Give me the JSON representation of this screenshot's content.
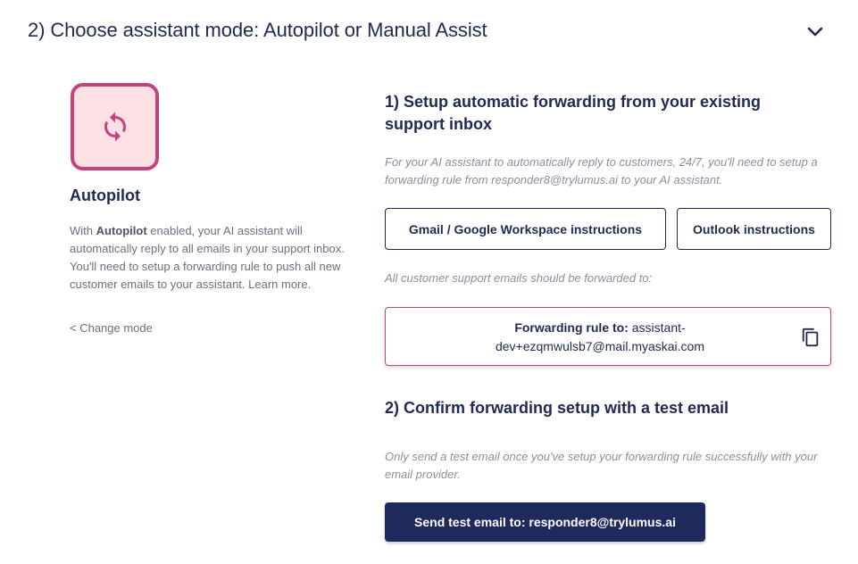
{
  "header": {
    "title": "2) Choose assistant mode: Autopilot or Manual Assist"
  },
  "mode": {
    "name": "Autopilot",
    "desc_prefix": "With ",
    "desc_bold": "Autopilot",
    "desc_rest": " enabled, your AI assistant will automatically reply to all emails in your support inbox. You'll need to setup a forwarding rule to push all new customer emails to your assistant. Learn more.",
    "change_link": "< Change mode",
    "accent_color": "#c6427c",
    "icon": "sync-arrows-icon"
  },
  "step1": {
    "title": "1) Setup automatic forwarding from your existing support inbox",
    "hint": "For your AI assistant to automatically reply to customers, 24/7, you'll need to setup a forwarding rule from responder8@trylumus.ai to your AI assistant.",
    "gmail_button": "Gmail / Google Workspace instructions",
    "outlook_button": "Outlook instructions",
    "forward_hint": "All customer support emails should be forwarded to:",
    "forward_label": "Forwarding rule to:",
    "forward_address": "assistant-dev+ezqmwulsb7@mail.myaskai.com",
    "copy_icon": "copy-icon"
  },
  "step2": {
    "title": "2) Confirm forwarding setup with a test email",
    "hint": "Only send a test email once you've setup your forwarding rule successfully with your email provider.",
    "send_button": "Send test email to: responder8@trylumus.ai"
  }
}
